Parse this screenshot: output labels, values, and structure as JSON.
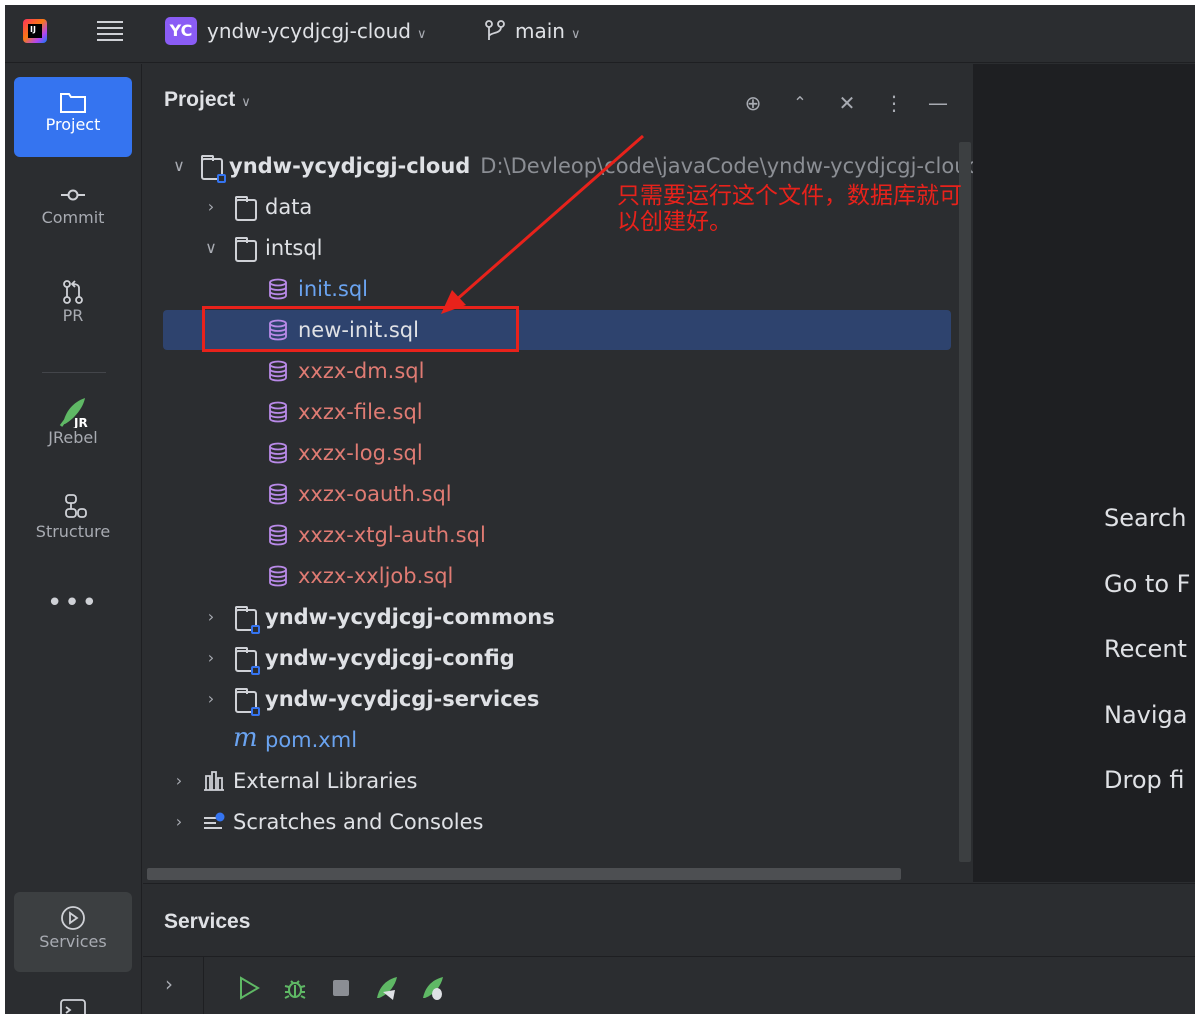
{
  "titlebar": {
    "project_badge": "YC",
    "project_name": "yndw-ycydjcgj-cloud",
    "branch": "main"
  },
  "toolstrip": {
    "items": [
      {
        "label": "Project",
        "icon": "folder-icon",
        "active": true
      },
      {
        "label": "Commit",
        "icon": "commit-icon"
      },
      {
        "label": "PR",
        "icon": "pull-request-icon"
      },
      {
        "label": "JRebel",
        "icon": "jrebel-icon"
      },
      {
        "label": "Structure",
        "icon": "structure-icon"
      }
    ],
    "more": "•••",
    "services_label": "Services"
  },
  "project_panel": {
    "title": "Project",
    "tree": {
      "root": {
        "name": "yndw-ycydjcgj-cloud",
        "path": "D:\\Devleop\\code\\javaCode\\yndw-ycydjcgj-cloud"
      },
      "data_folder": "data",
      "intsql_folder": "intsql",
      "sql_files": [
        "init.sql",
        "new-init.sql",
        "xxzx-dm.sql",
        "xxzx-file.sql",
        "xxzx-log.sql",
        "xxzx-oauth.sql",
        "xxzx-xtgl-auth.sql",
        "xxzx-xxljob.sql"
      ],
      "selected_file": "new-init.sql",
      "modules": [
        "yndw-ycydjcgj-commons",
        "yndw-ycydjcgj-config",
        "yndw-ycydjcgj-services"
      ],
      "pom": "pom.xml",
      "external_libraries": "External Libraries",
      "scratches": "Scratches and Consoles"
    }
  },
  "editor_hints": [
    "Search",
    "Go to F",
    "Recent",
    "Naviga",
    "Drop fi"
  ],
  "services_panel": {
    "title": "Services"
  },
  "annotation": {
    "text": "只需要运行这个文件，数据库就可以创建好。",
    "color": "#e8221b"
  },
  "colors": {
    "accent": "#3574f0",
    "selection": "#2e436e",
    "sql_modified": "#e07b73",
    "sql_new": "#6aa3f0",
    "run_green": "#5fb865"
  }
}
